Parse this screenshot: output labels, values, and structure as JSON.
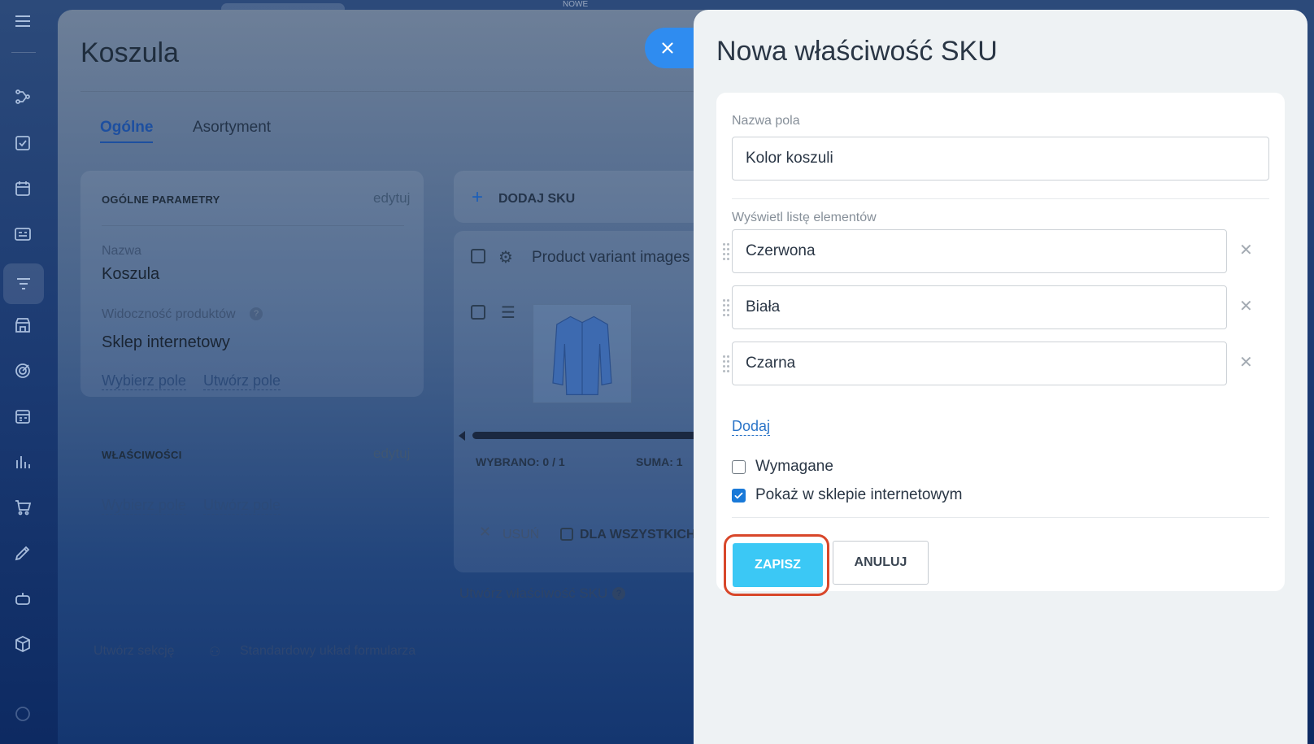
{
  "top_label": "NOWE",
  "product": {
    "title": "Koszula",
    "tabs": [
      {
        "label": "Ogólne"
      },
      {
        "label": "Asortyment"
      }
    ],
    "general": {
      "heading": "OGÓLNE PARAMETRY",
      "edit_label": "edytuj",
      "name_label": "Nazwa",
      "name_value": "Koszula",
      "visibility_label": "Widoczność produktów",
      "visibility_value": "Sklep internetowy",
      "choose_field": "Wybierz pole",
      "create_field": "Utwórz pole"
    },
    "properties": {
      "heading": "WŁAŚCIWOŚCI",
      "edit_label": "edytuj",
      "choose_field": "Wybierz pole",
      "create_field": "Utwórz pole"
    },
    "sku": {
      "add_label": "DODAJ SKU",
      "images_label": "Product variant images",
      "selected": "WYBRANO: 0 / 1",
      "sum": "SUMA: 1",
      "delete_label": "USUŃ",
      "for_all_label": "DLA WSZYSTKICH",
      "create_property": "Utwórz właściwość SKU"
    },
    "footer": {
      "create_section": "Utwórz sekcję",
      "standard_layout": "Standardowy układ formularza"
    }
  },
  "dialog": {
    "title": "Nowa właściwość SKU",
    "field_name_label": "Nazwa pola",
    "field_name_value": "Kolor koszuli",
    "list_label": "Wyświetl listę elementów",
    "items": [
      {
        "value": "Czerwona"
      },
      {
        "value": "Biała"
      },
      {
        "value": "Czarna"
      }
    ],
    "add_label": "Dodaj",
    "required_label": "Wymagane",
    "required_checked": false,
    "show_in_store_label": "Pokaż w sklepie internetowym",
    "show_in_store_checked": true,
    "save_label": "ZAPISZ",
    "cancel_label": "ANULUJ",
    "accent_color": "#3bc8f5",
    "highlight_color": "#d8472a"
  }
}
